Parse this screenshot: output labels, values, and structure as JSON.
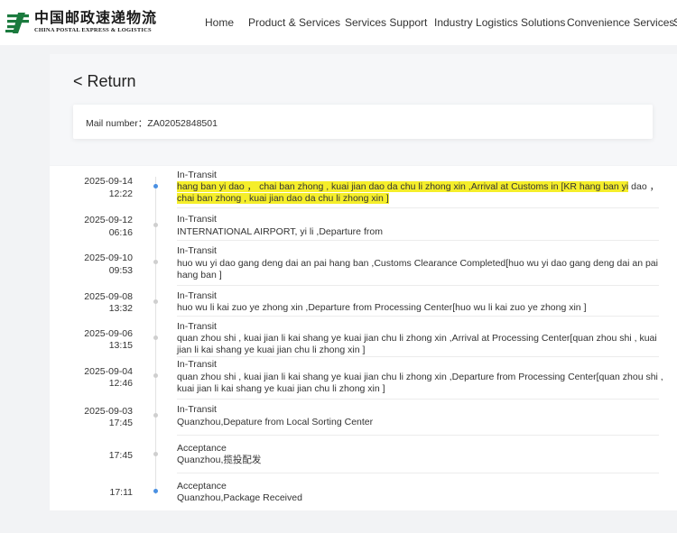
{
  "brand": {
    "name_cn": "中国邮政速递物流",
    "name_en": "CHINA POSTAL EXPRESS & LOGISTICS",
    "color": "#1b7a3e"
  },
  "nav": {
    "items": [
      "Home",
      "Product & Services",
      "Services Support",
      "Industry Logistics Solutions",
      "Convenience Services",
      "S"
    ]
  },
  "page": {
    "return_label": "< Return",
    "mail_number_label": "Mail number：",
    "mail_number": "ZA02052848501"
  },
  "events": [
    {
      "date": "2025-09-14",
      "time": "12:22",
      "status": "In-Transit",
      "desc_highlight": "hang ban yi dao ， chai ban zhong , kuai jian dao da chu li zhong xin ,Arrival at Customs in [KR hang ban yi",
      "desc_plain": " dao ，",
      "desc_highlight2": "chai ban zhong , kuai jian dao da chu li zhong xin ]",
      "dot": "blue"
    },
    {
      "date": "2025-09-12",
      "time": "06:16",
      "status": "In-Transit",
      "desc": "INTERNATIONAL AIRPORT, yi li ,Departure from"
    },
    {
      "date": "2025-09-10",
      "time": "09:53",
      "status": "In-Transit",
      "desc": "huo wu yi dao gang deng dai an pai hang ban ,Customs Clearance Completed[huo wu yi dao gang deng dai an pai hang ban ]"
    },
    {
      "date": "2025-09-08",
      "time": "13:32",
      "status": "In-Transit",
      "desc": "huo wu li kai zuo ye zhong xin ,Departure from Processing Center[huo wu li kai zuo ye zhong xin ]"
    },
    {
      "date": "2025-09-06",
      "time": "13:15",
      "status": "In-Transit",
      "desc": "quan zhou shi , kuai jian li kai shang ye kuai jian chu li zhong xin ,Arrival at Processing Center[quan zhou shi , kuai jian li kai shang ye kuai jian chu li zhong xin ]"
    },
    {
      "date": "2025-09-04",
      "time": "12:46",
      "status": "In-Transit",
      "desc": "quan zhou shi , kuai jian li kai shang ye kuai jian chu li zhong xin ,Departure from Processing Center[quan zhou shi , kuai jian li kai shang ye kuai jian chu li zhong xin ]"
    },
    {
      "date": "2025-09-03",
      "time": "17:45",
      "status": "In-Transit",
      "desc": "Quanzhou,Depature from Local Sorting Center"
    },
    {
      "date": "",
      "time": "17:45",
      "status": "Acceptance",
      "desc": "Quanzhou,揽投配发"
    },
    {
      "date": "",
      "time": "17:11",
      "status": "Acceptance",
      "desc": "Quanzhou,Package Received",
      "dot": "blue"
    }
  ],
  "colors": {
    "highlight": "#f5ee2a",
    "timeline_dot_active": "#4a90e2",
    "timeline_dot": "#cfcfcf"
  }
}
